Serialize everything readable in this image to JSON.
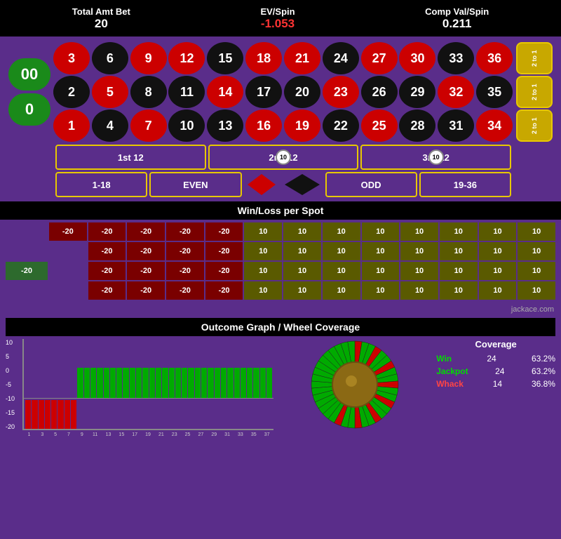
{
  "header": {
    "total_amt_bet_label": "Total Amt Bet",
    "total_amt_bet_value": "20",
    "ev_spin_label": "EV/Spin",
    "ev_spin_value": "-1.053",
    "comp_val_label": "Comp Val/Spin",
    "comp_val_value": "0.211"
  },
  "roulette": {
    "numbers": [
      {
        "n": "3",
        "color": "red"
      },
      {
        "n": "6",
        "color": "black"
      },
      {
        "n": "9",
        "color": "red"
      },
      {
        "n": "12",
        "color": "red"
      },
      {
        "n": "15",
        "color": "black"
      },
      {
        "n": "18",
        "color": "red"
      },
      {
        "n": "21",
        "color": "red"
      },
      {
        "n": "24",
        "color": "black"
      },
      {
        "n": "27",
        "color": "red"
      },
      {
        "n": "30",
        "color": "red"
      },
      {
        "n": "33",
        "color": "black"
      },
      {
        "n": "36",
        "color": "red"
      },
      {
        "n": "2",
        "color": "black"
      },
      {
        "n": "5",
        "color": "red"
      },
      {
        "n": "8",
        "color": "black"
      },
      {
        "n": "11",
        "color": "black"
      },
      {
        "n": "14",
        "color": "red"
      },
      {
        "n": "17",
        "color": "black"
      },
      {
        "n": "20",
        "color": "black"
      },
      {
        "n": "23",
        "color": "red"
      },
      {
        "n": "26",
        "color": "black"
      },
      {
        "n": "29",
        "color": "black"
      },
      {
        "n": "32",
        "color": "red"
      },
      {
        "n": "35",
        "color": "black"
      },
      {
        "n": "1",
        "color": "red"
      },
      {
        "n": "4",
        "color": "black"
      },
      {
        "n": "7",
        "color": "red"
      },
      {
        "n": "10",
        "color": "black"
      },
      {
        "n": "13",
        "color": "black"
      },
      {
        "n": "16",
        "color": "red"
      },
      {
        "n": "19",
        "color": "red"
      },
      {
        "n": "22",
        "color": "black"
      },
      {
        "n": "25",
        "color": "red"
      },
      {
        "n": "28",
        "color": "black"
      },
      {
        "n": "31",
        "color": "black"
      },
      {
        "n": "34",
        "color": "red"
      }
    ],
    "zeros": [
      "00",
      "0"
    ],
    "two_to_one": [
      "2 to 1",
      "2 to 1",
      "2 to 1"
    ],
    "dozens": [
      "1st 12",
      "2nd 12",
      "3rd 12"
    ],
    "dozen_chips": [
      null,
      "10",
      "10"
    ],
    "bottom_row": [
      "1-18",
      "EVEN",
      "ODD",
      "19-36"
    ]
  },
  "winloss": {
    "title": "Win/Loss per Spot",
    "rows": [
      [
        null,
        "-20",
        "-20",
        "-20",
        "-20",
        "-20",
        "10",
        "10",
        "10",
        "10",
        "10",
        "10",
        "10",
        "10"
      ],
      [
        null,
        null,
        "-20",
        "-20",
        "-20",
        "-20",
        "10",
        "10",
        "10",
        "10",
        "10",
        "10",
        "10",
        "10"
      ],
      [
        "-20",
        null,
        "-20",
        "-20",
        "-20",
        "-20",
        "10",
        "10",
        "10",
        "10",
        "10",
        "10",
        "10",
        "10"
      ],
      [
        null,
        null,
        "-20",
        "-20",
        "-20",
        "-20",
        "10",
        "10",
        "10",
        "10",
        "10",
        "10",
        "10",
        "10"
      ]
    ],
    "attribution": "jackace.com"
  },
  "outcome": {
    "title": "Outcome Graph / Wheel Coverage",
    "y_labels": [
      "10",
      "5",
      "0",
      "-5",
      "-10",
      "-15",
      "-20"
    ],
    "x_labels": [
      "1",
      "3",
      "5",
      "7",
      "9",
      "11",
      "13",
      "15",
      "17",
      "19",
      "21",
      "23",
      "25",
      "27",
      "29",
      "31",
      "33",
      "35",
      "37"
    ],
    "bars": [
      {
        "val": -20,
        "type": "neg"
      },
      {
        "val": -20,
        "type": "neg"
      },
      {
        "val": -20,
        "type": "neg"
      },
      {
        "val": -20,
        "type": "neg"
      },
      {
        "val": -20,
        "type": "neg"
      },
      {
        "val": -20,
        "type": "neg"
      },
      {
        "val": -20,
        "type": "neg"
      },
      {
        "val": -20,
        "type": "neg"
      },
      {
        "val": 10,
        "type": "pos"
      },
      {
        "val": 10,
        "type": "pos"
      },
      {
        "val": 10,
        "type": "pos"
      },
      {
        "val": 10,
        "type": "pos"
      },
      {
        "val": 10,
        "type": "pos"
      },
      {
        "val": 10,
        "type": "pos"
      },
      {
        "val": 10,
        "type": "pos"
      },
      {
        "val": 10,
        "type": "pos"
      },
      {
        "val": 10,
        "type": "pos"
      },
      {
        "val": 10,
        "type": "pos"
      },
      {
        "val": 10,
        "type": "pos"
      },
      {
        "val": 10,
        "type": "pos"
      },
      {
        "val": 10,
        "type": "pos"
      },
      {
        "val": 10,
        "type": "pos"
      },
      {
        "val": 10,
        "type": "pos"
      },
      {
        "val": 10,
        "type": "pos"
      },
      {
        "val": 10,
        "type": "pos"
      },
      {
        "val": 10,
        "type": "pos"
      },
      {
        "val": 10,
        "type": "pos"
      },
      {
        "val": 10,
        "type": "pos"
      },
      {
        "val": 10,
        "type": "pos"
      },
      {
        "val": 10,
        "type": "pos"
      },
      {
        "val": 10,
        "type": "pos"
      },
      {
        "val": 10,
        "type": "pos"
      },
      {
        "val": 10,
        "type": "pos"
      },
      {
        "val": 10,
        "type": "pos"
      },
      {
        "val": 10,
        "type": "pos"
      },
      {
        "val": 10,
        "type": "pos"
      },
      {
        "val": 10,
        "type": "pos"
      },
      {
        "val": 10,
        "type": "pos"
      }
    ],
    "coverage": {
      "title": "Coverage",
      "win_label": "Win",
      "win_count": "24",
      "win_pct": "63.2%",
      "jackpot_label": "Jackpot",
      "jackpot_count": "24",
      "jackpot_pct": "63.2%",
      "whack_label": "Whack",
      "whack_count": "14",
      "whack_pct": "36.8%"
    }
  }
}
